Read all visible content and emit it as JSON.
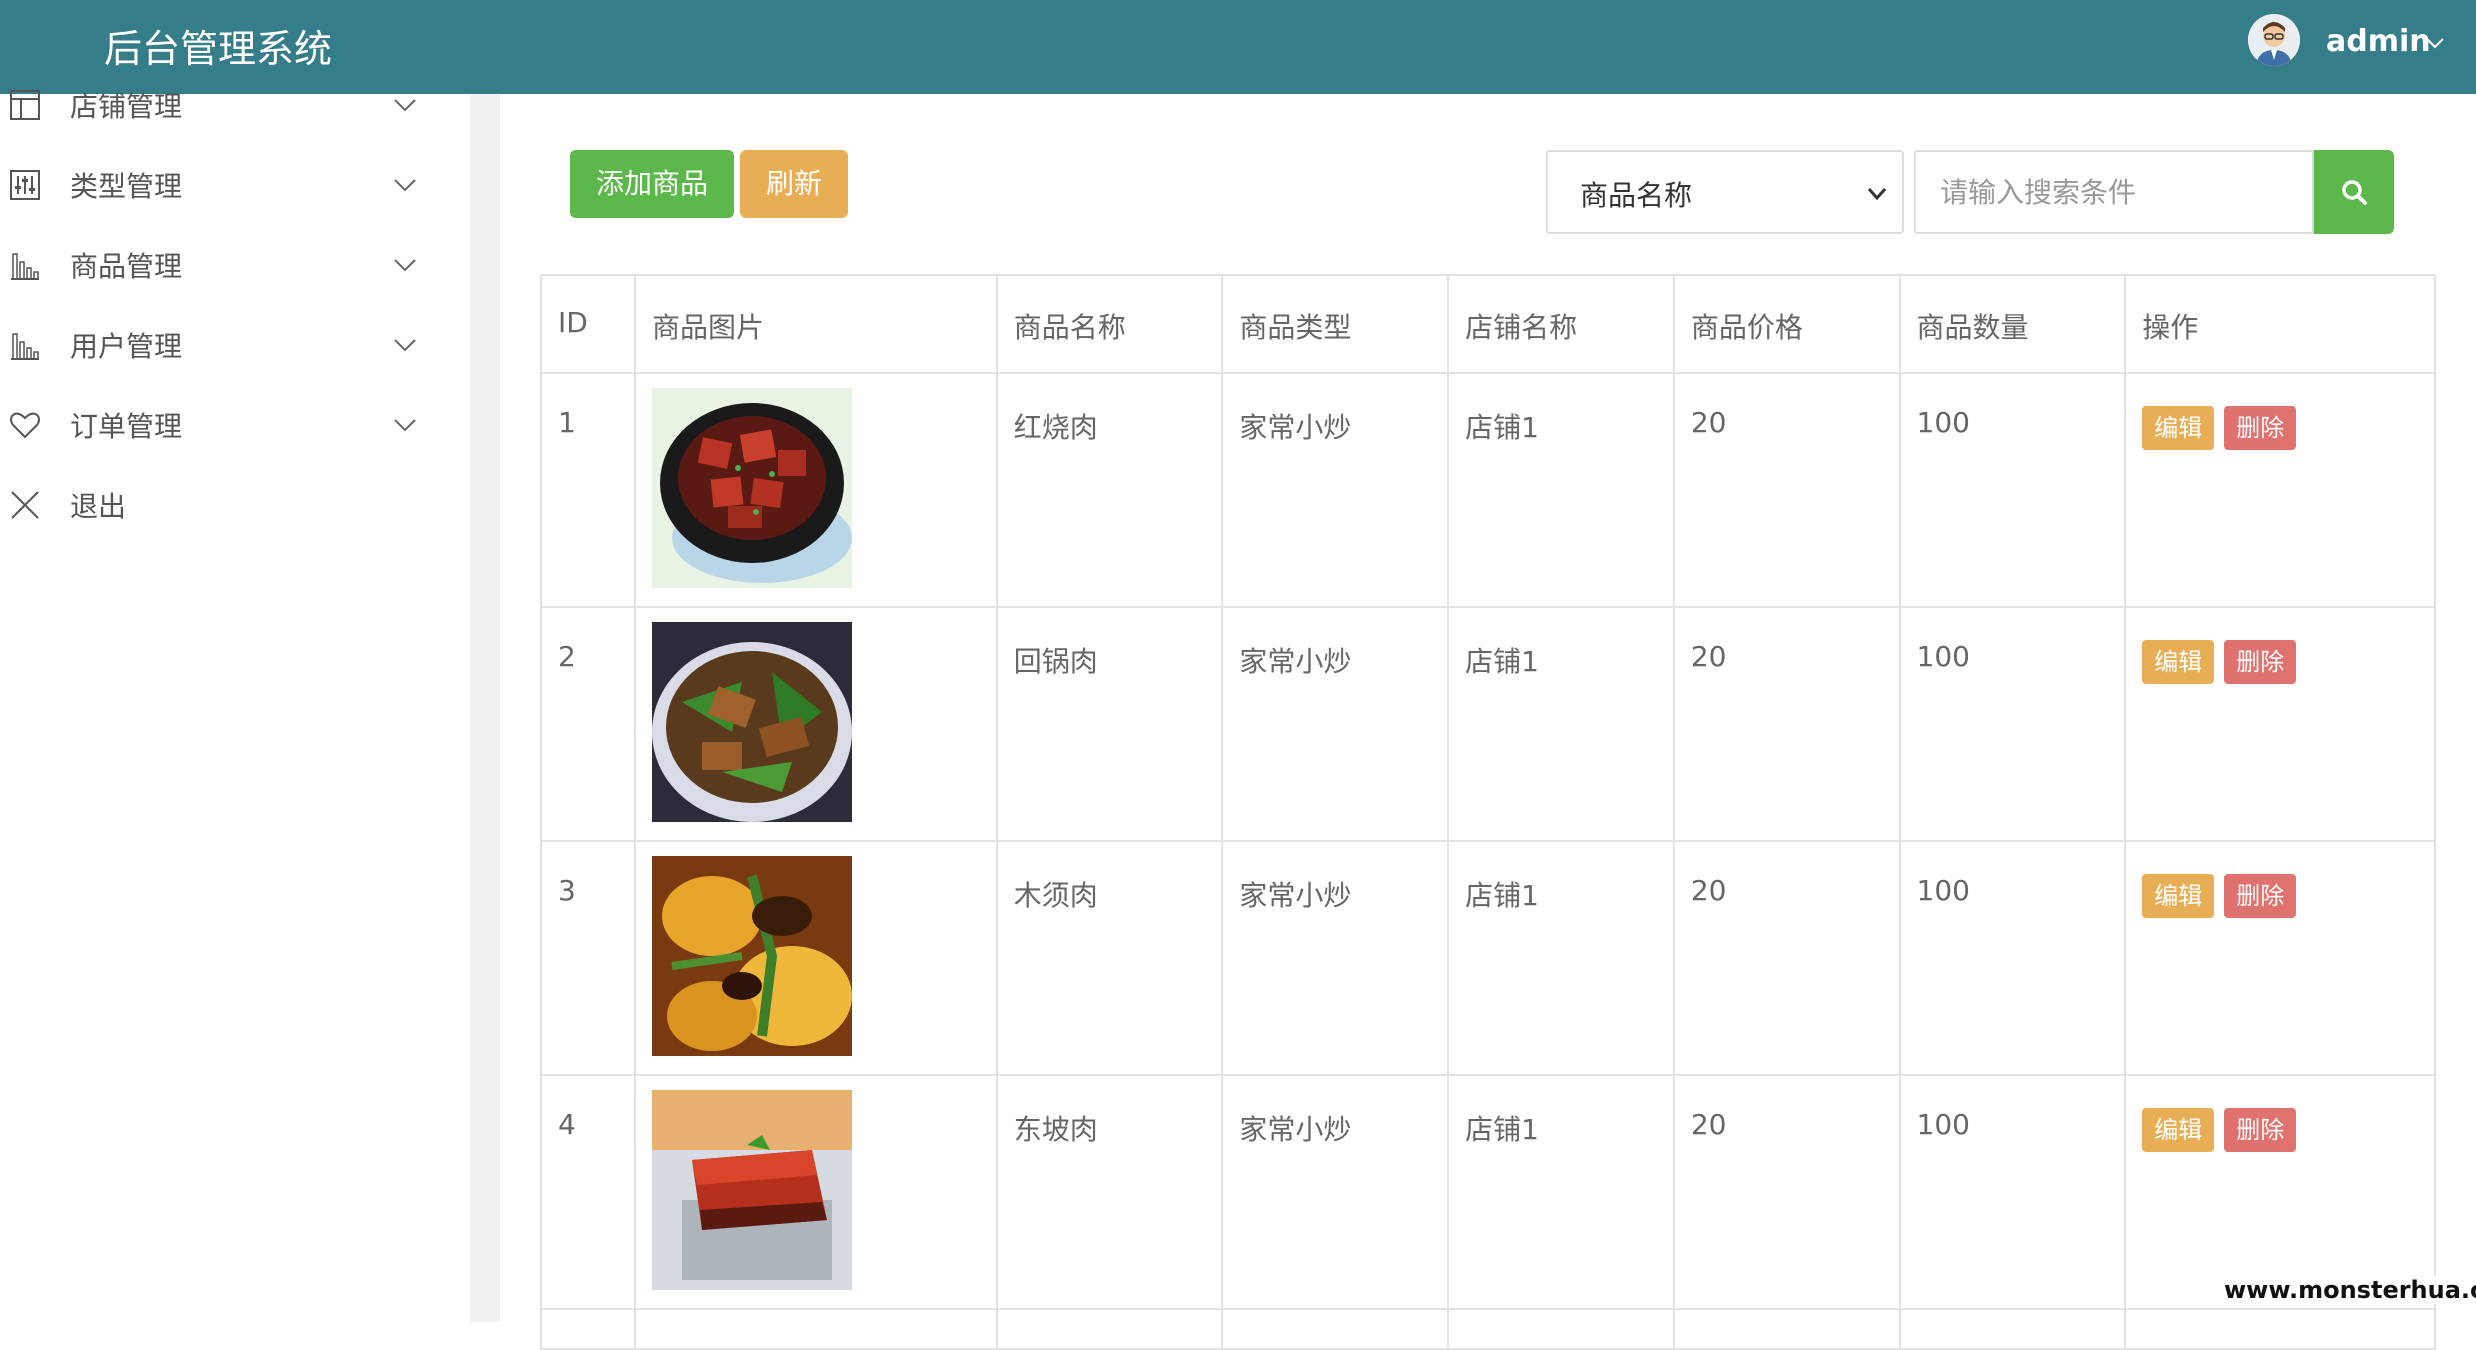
{
  "header": {
    "title": "后台管理系统",
    "user_name": "admin",
    "bg_color": "#367d8a"
  },
  "sidebar": {
    "items": [
      {
        "label": "店铺管理",
        "icon": "layout-icon"
      },
      {
        "label": "类型管理",
        "icon": "sliders-icon"
      },
      {
        "label": "商品管理",
        "icon": "bar-chart-icon"
      },
      {
        "label": "用户管理",
        "icon": "bar-chart-icon"
      },
      {
        "label": "订单管理",
        "icon": "heart-icon"
      },
      {
        "label": "退出",
        "icon": "close-icon"
      }
    ]
  },
  "toolbar": {
    "add_label": "添加商品",
    "refresh_label": "刷新",
    "search_field_selected": "商品名称",
    "search_placeholder": "请输入搜索条件"
  },
  "table": {
    "headers": [
      "ID",
      "商品图片",
      "商品名称",
      "商品类型",
      "店铺名称",
      "商品价格",
      "商品数量",
      "操作"
    ],
    "rows": [
      {
        "id": "1",
        "image": "red-braised-pork-photo",
        "name": "红烧肉",
        "type": "家常小炒",
        "shop": "店铺1",
        "price": "20",
        "qty": "100"
      },
      {
        "id": "2",
        "image": "twice-cooked-pork-photo",
        "name": "回锅肉",
        "type": "家常小炒",
        "shop": "店铺1",
        "price": "20",
        "qty": "100"
      },
      {
        "id": "3",
        "image": "moo-shu-pork-photo",
        "name": "木须肉",
        "type": "家常小炒",
        "shop": "店铺1",
        "price": "20",
        "qty": "100"
      },
      {
        "id": "4",
        "image": "dongpo-pork-photo",
        "name": "东坡肉",
        "type": "家常小炒",
        "shop": "店铺1",
        "price": "20",
        "qty": "100"
      }
    ],
    "edit_label": "编辑",
    "delete_label": "删除"
  },
  "watermark": "www.monsterhua.com",
  "colors": {
    "primary_green": "#5cb84a",
    "warning_orange": "#e8ae55",
    "danger_red": "#d9534f"
  }
}
